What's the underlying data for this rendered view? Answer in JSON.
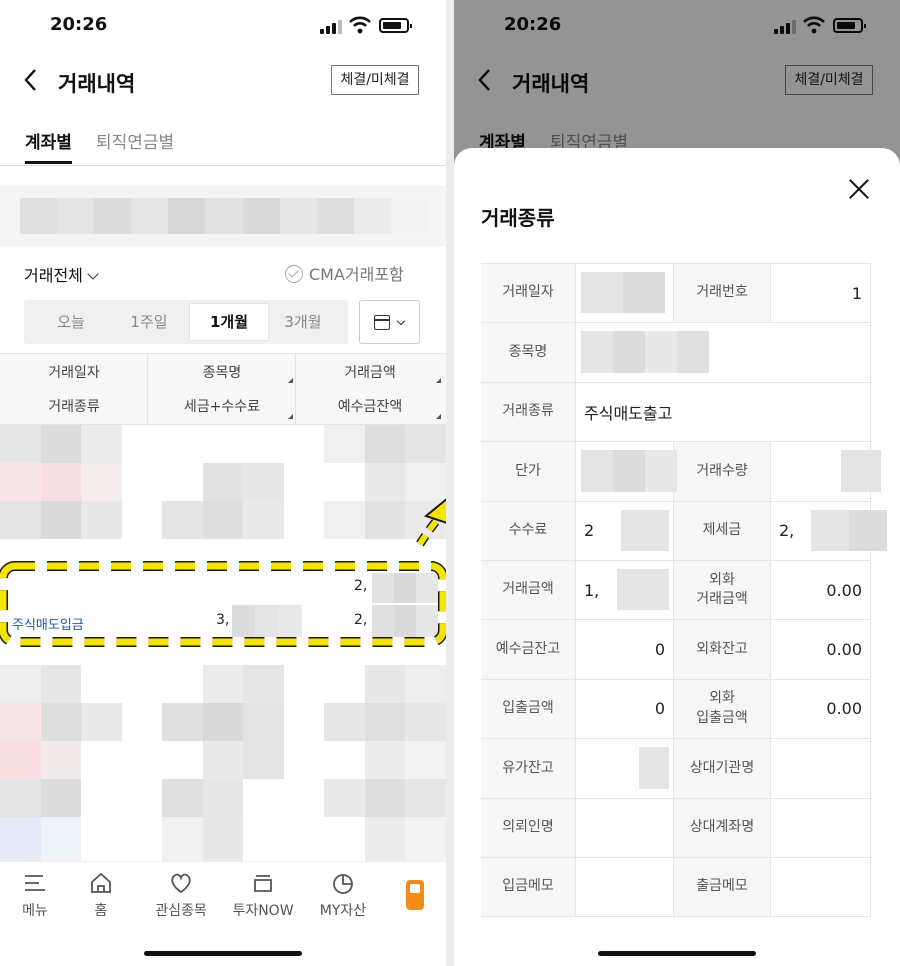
{
  "status_bar": {
    "time": "20:26"
  },
  "left": {
    "header": {
      "title": "거래내역",
      "action_button": "체결/미체결"
    },
    "tabs": [
      "계좌별",
      "퇴직연금별"
    ],
    "filter": {
      "type_label": "거래전체",
      "cma_label": "CMA거래포함"
    },
    "periods": [
      "오늘",
      "1주일",
      "1개월",
      "3개월"
    ],
    "active_period": "1개월",
    "table_header": {
      "row1": [
        "거래일자",
        "종목명",
        "거래금액"
      ],
      "row2": [
        "거래종류",
        "세금+수수료",
        "예수금잔액"
      ]
    },
    "highlighted_row": {
      "type_link": "주식매도입금",
      "amount_top": "2,",
      "tax_fee": "3,",
      "balance": "2,"
    },
    "bottom_nav": [
      "메뉴",
      "홈",
      "관심종목",
      "투자NOW",
      "MY자산"
    ]
  },
  "right": {
    "sheet_title": "거래종류",
    "header": {
      "title": "거래내역",
      "action_button": "체결/미체결"
    },
    "tabs": [
      "계좌별",
      "퇴직연금별"
    ],
    "details": [
      {
        "label": "거래일자",
        "value": "",
        "label2": "거래번호",
        "value2": "1"
      },
      {
        "label": "종목명",
        "value": ""
      },
      {
        "label": "거래종류",
        "value": "주식매도출고"
      },
      {
        "label": "단가",
        "value": "",
        "label2": "거래수량",
        "value2": ""
      },
      {
        "label": "수수료",
        "value": "2",
        "label2": "제세금",
        "value2": "2,"
      },
      {
        "label": "거래금액",
        "value": "1,",
        "label2": "외화 거래금액",
        "value2": "0.00"
      },
      {
        "label": "예수금잔고",
        "value": "0",
        "label2": "외화잔고",
        "value2": "0.00"
      },
      {
        "label": "입출금액",
        "value": "0",
        "label2": "외화 입출금액",
        "value2": "0.00"
      },
      {
        "label": "유가잔고",
        "value": "",
        "label2": "상대기관명",
        "value2": ""
      },
      {
        "label": "의뢰인명",
        "value": "",
        "label2": "상대계좌명",
        "value2": ""
      },
      {
        "label": "입금메모",
        "value": "",
        "label2": "출금메모",
        "value2": ""
      }
    ]
  },
  "colors": {
    "highlight": "#f4e500",
    "link": "#1a5aa8",
    "nav_accent": "#f28c1b"
  }
}
